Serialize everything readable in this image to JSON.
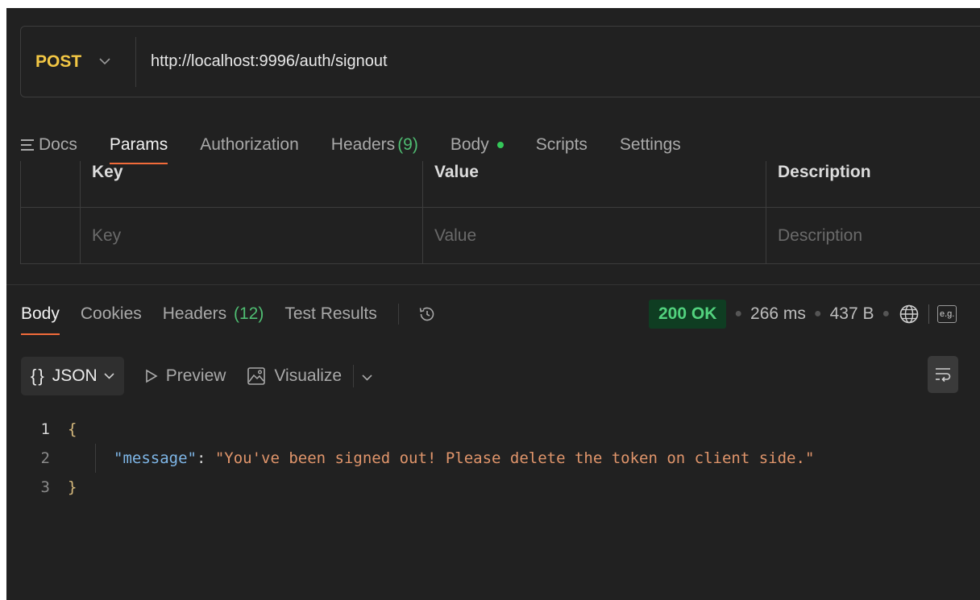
{
  "request": {
    "method": "POST",
    "url": "http://localhost:9996/auth/signout"
  },
  "request_tabs": {
    "docs": "Docs",
    "params": "Params",
    "authorization": "Authorization",
    "headers": "Headers",
    "headers_count": "(9)",
    "body": "Body",
    "scripts": "Scripts",
    "settings": "Settings",
    "active": "params",
    "body_indicator_color": "#34c759"
  },
  "params_table": {
    "columns": [
      "Key",
      "Value",
      "Description"
    ],
    "placeholders": {
      "key": "Key",
      "value": "Value",
      "description": "Description"
    }
  },
  "response_tabs": {
    "body": "Body",
    "cookies": "Cookies",
    "headers": "Headers",
    "headers_count": "(12)",
    "test_results": "Test Results",
    "active": "body"
  },
  "response_status": {
    "status": "200 OK",
    "time": "266 ms",
    "size": "437 B",
    "examples_badge": "e.g."
  },
  "format_toolbar": {
    "format": "JSON",
    "format_braces": "{}",
    "preview": "Preview",
    "visualize": "Visualize"
  },
  "response_body": {
    "lines": [
      {
        "number": "1",
        "text": "{"
      },
      {
        "number": "2",
        "key": "\"message\"",
        "separator": ": ",
        "value": "\"You've been signed out! Please delete the token on client side.\""
      },
      {
        "number": "3",
        "text": "}"
      }
    ]
  },
  "theme": {
    "accent": "#f26b3a",
    "method_color": "#f3c744",
    "success_color": "#52d27e",
    "count_color": "#4fbd72"
  }
}
